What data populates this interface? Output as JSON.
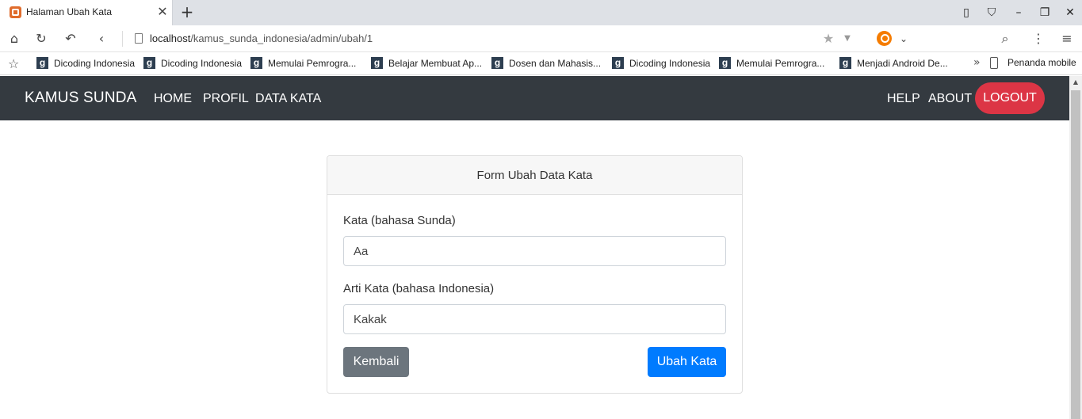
{
  "browser": {
    "tab_title": "Halaman Ubah Kata",
    "url_host": "localhost",
    "url_path": "/kamus_sunda_indonesia/admin/ubah/1",
    "bookmarks": [
      "Dicoding Indonesia",
      "Dicoding Indonesia",
      "Memulai Pemrogra...",
      "Belajar Membuat Ap...",
      "Dosen dan Mahasis...",
      "Dicoding Indonesia",
      "Memulai Pemrogra...",
      "Menjadi Android De..."
    ],
    "bookmarks_more": "»",
    "mobile_bookmarks": "Penanda mobile"
  },
  "navbar": {
    "brand": "KAMUS SUNDA",
    "links": [
      "HOME",
      "PROFIL",
      "DATA KATA"
    ],
    "help": "HELP",
    "about": "ABOUT",
    "logout": "LOGOUT",
    "background": "#343a40"
  },
  "form": {
    "title": "Form Ubah Data Kata",
    "kata_label": "Kata (bahasa Sunda)",
    "kata_value": "Aa",
    "arti_label": "Arti Kata (bahasa Indonesia)",
    "arti_value": "Kakak",
    "back_button": "Kembali",
    "submit_button": "Ubah Kata"
  },
  "colors": {
    "logout": "#dc3545",
    "submit": "#007bff",
    "back": "#6c757d"
  }
}
